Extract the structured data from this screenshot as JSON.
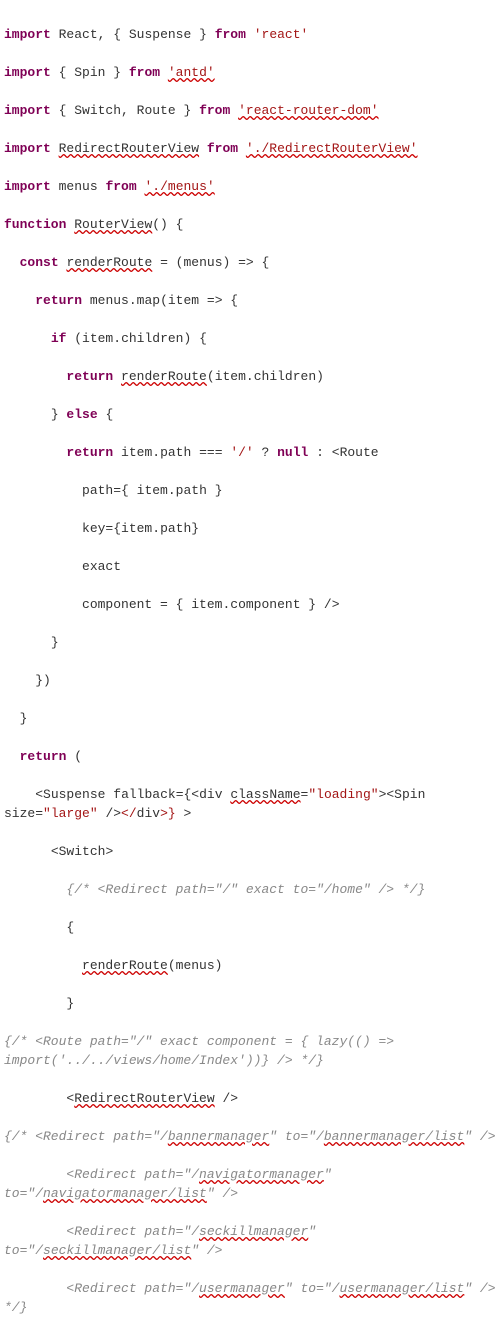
{
  "kw": {
    "import": "import",
    "from": "from",
    "function": "function",
    "const": "const",
    "return": "return",
    "if": "if",
    "else": "else",
    "null": "null",
    "exact": "exact"
  },
  "id": {
    "React": "React",
    "Suspense": "Suspense",
    "Spin": "Spin",
    "Switch": "Switch",
    "Route": "Route",
    "RedirectRouterView": "RedirectRouterView",
    "menus": "menus",
    "RouterView": "RouterView",
    "renderRoute": "renderRoute",
    "item": "item",
    "children": "children",
    "path": "path",
    "key": "key",
    "component": "component",
    "div": "div",
    "className": "className",
    "size": "size",
    "fallback": "fallback"
  },
  "str": {
    "react": "'react'",
    "antd": "'antd'",
    "rrdom": "'react-router-dom'",
    "rrv": "'./RedirectRouterView'",
    "menus": "'./menus'",
    "slash": "'/'",
    "loading": "\"loading\"",
    "large": "\"large\""
  },
  "cm": {
    "redirectHome": "{/* <Redirect path=\"/\" exact to=\"/home\" /> */}",
    "routeLazy": "{/* <Route path=\"/\" exact component = { lazy(() => import('../../views/home/Index'))} /> */}",
    "redOpen": "{/* <Redirect path=\"/",
    "redBanner1": "bannermanager",
    "redBanner2": "\" to=\"/",
    "redBannerList": "bannermanager/list",
    "redClose": "\" />",
    "navig": "navigatormanager",
    "navigList": "navigatormanager/list",
    "seck": "seckillmanager",
    "seckList": "seckillmanager/list",
    "user": "usermanager",
    "userList": "usermanager/list",
    "ctag": "\" /> */}",
    "prefix": "        <Redirect path=\"/"
  },
  "chart_data": null
}
